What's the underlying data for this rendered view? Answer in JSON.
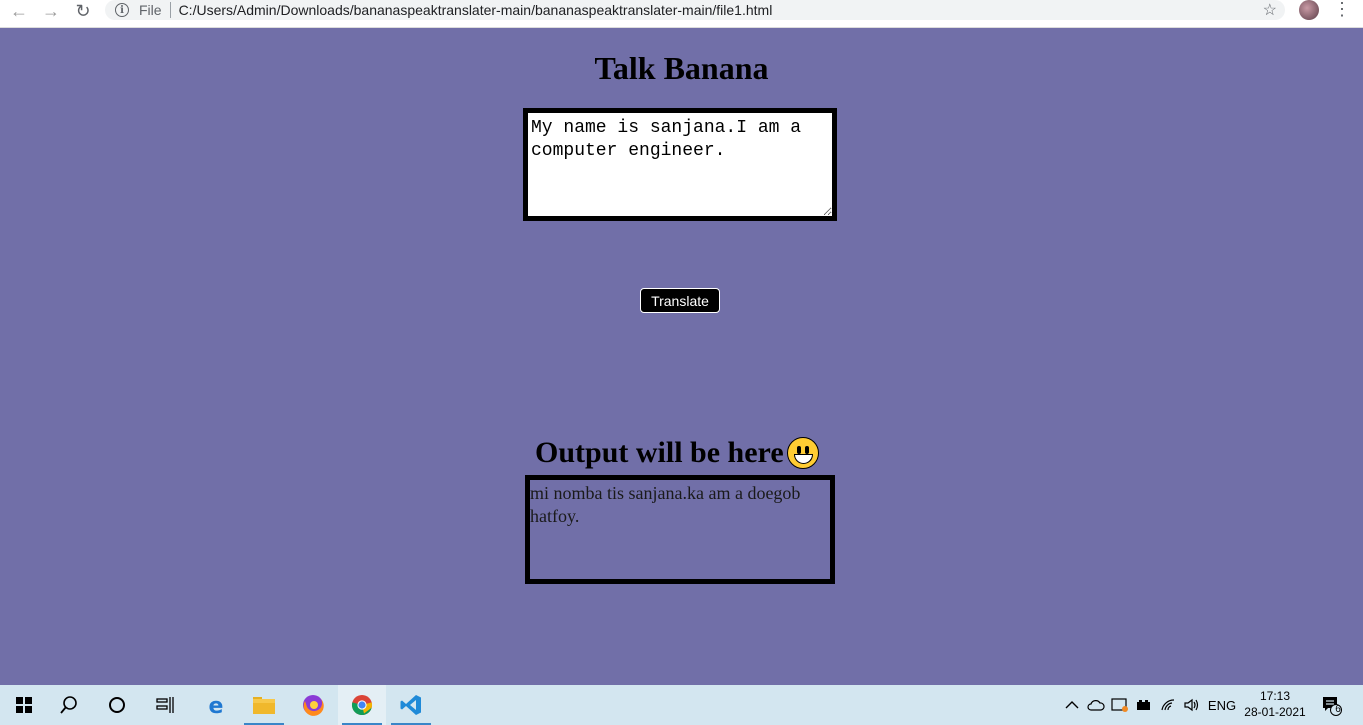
{
  "browser": {
    "back_icon": "arrow-left-icon",
    "forward_icon": "arrow-right-icon",
    "reload_icon": "reload-icon",
    "scheme_label": "File",
    "url": "C:/Users/Admin/Downloads/bananaspeaktranslater-main/bananaspeaktranslater-main/file1.html"
  },
  "page": {
    "title": "Talk Banana",
    "input_value": "My name is sanjana.I am a computer engineer.",
    "translate_label": "Translate",
    "output_heading": "Output will be here",
    "output_text": "mi nomba tis sanjana.ka am a doegob hatfoy."
  },
  "taskbar": {
    "language": "ENG",
    "time": "17:13",
    "date": "28-01-2021",
    "notification_count": "6"
  },
  "colors": {
    "page_background": "#716fa8",
    "taskbar_background": "#d3e6f0"
  }
}
